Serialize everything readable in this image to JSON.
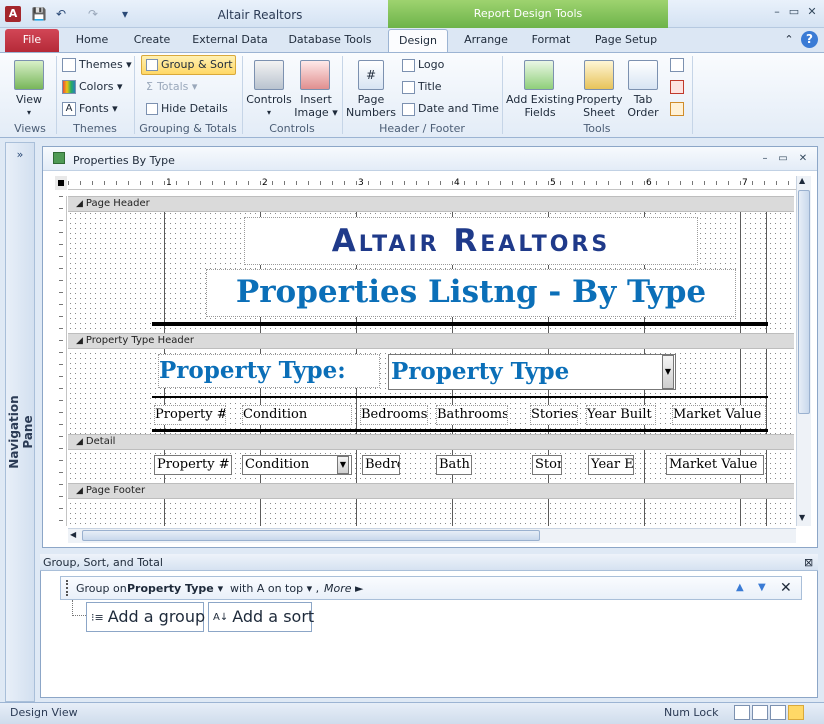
{
  "window": {
    "title": "Altair Realtors",
    "context_tab": "Report Design Tools",
    "controls": {
      "minimize": "–",
      "restore": "▭",
      "close": "✕"
    }
  },
  "qat": {
    "app_icon": "A",
    "save": "💾",
    "undo": "↶",
    "redo": "↷",
    "customize": "▾"
  },
  "tabs": [
    {
      "label": "File"
    },
    {
      "label": "Home"
    },
    {
      "label": "Create"
    },
    {
      "label": "External Data"
    },
    {
      "label": "Database Tools"
    },
    {
      "label": "Design"
    },
    {
      "label": "Arrange"
    },
    {
      "label": "Format"
    },
    {
      "label": "Page Setup"
    }
  ],
  "ribbon_extras": {
    "collapse": "⌃",
    "help": "?"
  },
  "ribbon": {
    "views": {
      "view": "View",
      "group": "Views"
    },
    "themes": {
      "themes": "Themes",
      "colors": "Colors",
      "fonts": "Fonts",
      "group": "Themes"
    },
    "grouping": {
      "group_sort": "Group & Sort",
      "totals": "Totals",
      "hide_details": "Hide Details",
      "group": "Grouping & Totals"
    },
    "controls": {
      "controls": "Controls",
      "insert_image_1": "Insert",
      "insert_image_2": "Image",
      "group": "Controls"
    },
    "header_footer": {
      "page_numbers_1": "Page",
      "page_numbers_2": "Numbers",
      "logo": "Logo",
      "title": "Title",
      "date_time": "Date and Time",
      "group": "Header / Footer"
    },
    "tools": {
      "add_fields_1": "Add Existing",
      "add_fields_2": "Fields",
      "property_sheet_1": "Property",
      "property_sheet_2": "Sheet",
      "tab_order_1": "Tab",
      "tab_order_2": "Order",
      "group": "Tools"
    }
  },
  "nav_pane": {
    "toggle": "»",
    "label": "Navigation Pane"
  },
  "report": {
    "title": "Properties By Type",
    "ruler_numbers": [
      "1",
      "2",
      "3",
      "4",
      "5",
      "6",
      "7"
    ],
    "sections": {
      "page_header": "Page Header",
      "type_header": "Property Type Header",
      "detail": "Detail",
      "page_footer": "Page Footer"
    },
    "company_title": "Altair Realtors",
    "report_heading": "Properties Listng - By Type",
    "type_label": "Property Type:",
    "type_field": "Property Type",
    "column_headers": [
      "Property #",
      "Condition",
      "Bedrooms",
      "Bathrooms",
      "Stories",
      "Year Built",
      "Market Value"
    ],
    "detail_fields": [
      "Property #",
      "Condition",
      "Bedrc",
      "Bath:",
      "Stor",
      "Year E",
      "Market Value"
    ]
  },
  "gst": {
    "title": "Group, Sort, and Total",
    "group_on": "Group on",
    "group_field": "Property Type",
    "order": "with A on top",
    "more": "More ►",
    "add_group": "Add a group",
    "add_sort": "Add a sort"
  },
  "status": {
    "text": "Design View",
    "num_lock": "Num Lock"
  },
  "colors": {
    "title_blue": "#1f3a8a",
    "heading_blue": "#0b6fb8",
    "file_red": "#c0392b",
    "context_green": "#74b94f"
  }
}
